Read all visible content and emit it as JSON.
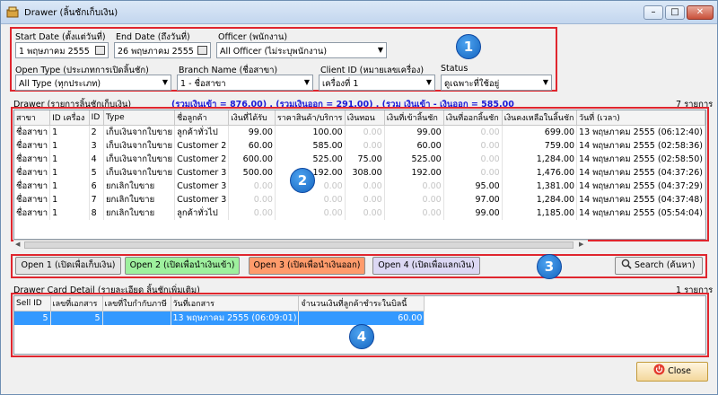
{
  "window": {
    "title": "Drawer (ลิ้นชักเก็บเงิน)",
    "minimize": "–",
    "maximize": "□",
    "close": "✕"
  },
  "filters": {
    "start_date_label": "Start Date (ตั้งแต่วันที่)",
    "start_date_value": "1 พฤษภาคม   2555",
    "end_date_label": "End Date (ถึงวันที่)",
    "end_date_value": "26 พฤษภาคม  2555",
    "officer_label": "Officer (พนักงาน)",
    "officer_value": "All Officer (ไม่ระบุพนักงาน)",
    "open_type_label": "Open Type (ประเภทการเปิดลิ้นชัก)",
    "open_type_value": "All Type (ทุกประเภท)",
    "branch_label": "Branch Name (ชื่อสาขา)",
    "branch_value": "1 - ชื่อสาขา",
    "client_label": "Client ID (หมายเลขเครื่อง)",
    "client_value": "เครื่องที่ 1",
    "status_label": "Status",
    "status_value": "ดูเฉพาะที่ใช้อยู่"
  },
  "drawer": {
    "label": "Drawer (รายการลิ้นชักเก็บเงิน)",
    "summary": "(รวมเงินเข้า = 876.00) , (รวมเงินออก = 291.00) , (รวม เงินเข้า - เงินออก = 585.00",
    "count": "7 รายการ",
    "columns": [
      "สาขา",
      "ID เครื่อง",
      "ID",
      "Type",
      "ชื่อลูกค้า",
      "เงินที่ได้รับ",
      "ราคาสินค้า/บริการ",
      "เงินทอน",
      "เงินที่เข้าลิ้นชัก",
      "เงินที่ออกลิ้นชัก",
      "เงินคงเหลือในลิ้นชัก",
      "วันที่ (เวลา)"
    ],
    "rows": [
      [
        "ชื่อสาขา",
        "1",
        "2",
        "เก็บเงินจากใบขาย",
        "ลูกค้าทั่วไป",
        "99.00",
        "100.00",
        "0.00",
        "99.00",
        "0.00",
        "699.00",
        "13 พฤษภาคม  2555  (06:12:40)"
      ],
      [
        "ชื่อสาขา",
        "1",
        "3",
        "เก็บเงินจากใบขาย",
        "Customer 2",
        "60.00",
        "585.00",
        "0.00",
        "60.00",
        "0.00",
        "759.00",
        "14 พฤษภาคม  2555  (02:58:36)"
      ],
      [
        "ชื่อสาขา",
        "1",
        "4",
        "เก็บเงินจากใบขาย",
        "Customer 2",
        "600.00",
        "525.00",
        "75.00",
        "525.00",
        "0.00",
        "1,284.00",
        "14 พฤษภาคม  2555  (02:58:50)"
      ],
      [
        "ชื่อสาขา",
        "1",
        "5",
        "เก็บเงินจากใบขาย",
        "Customer 3",
        "500.00",
        "192.00",
        "308.00",
        "192.00",
        "0.00",
        "1,476.00",
        "14 พฤษภาคม  2555  (04:37:26)"
      ],
      [
        "ชื่อสาขา",
        "1",
        "6",
        "ยกเลิกใบขาย",
        "Customer 3",
        "0.00",
        "0.00",
        "0.00",
        "0.00",
        "95.00",
        "1,381.00",
        "14 พฤษภาคม  2555  (04:37:29)"
      ],
      [
        "ชื่อสาขา",
        "1",
        "7",
        "ยกเลิกใบขาย",
        "Customer 3",
        "0.00",
        "0.00",
        "0.00",
        "0.00",
        "97.00",
        "1,284.00",
        "14 พฤษภาคม  2555  (04:37:48)"
      ],
      [
        "ชื่อสาขา",
        "1",
        "8",
        "ยกเลิกใบขาย",
        "ลูกค้าทั่วไป",
        "0.00",
        "0.00",
        "0.00",
        "0.00",
        "99.00",
        "1,185.00",
        "14 พฤษภาคม  2555  (05:54:04)"
      ]
    ]
  },
  "actions": {
    "open1": "Open 1 (เปิดเพื่อเก็บเงิน)",
    "open2": "Open 2 (เปิดเพื่อนำเงินเข้า)",
    "open3": "Open 3 (เปิดเพื่อนำเงินออก)",
    "open4": "Open 4 (เปิดเพื่อแลกเงิน)",
    "search": "Search (ค้นหา)"
  },
  "detail": {
    "label": "Drawer Card Detail (รายละเอียด ลิ้นชักเพิ่มเติม)",
    "count": "1 รายการ",
    "columns": [
      "Sell ID",
      "เลขที่เอกสาร",
      "เลขที่ใบกำกับภาษี",
      "วันที่เอกสาร",
      "จำนวนเงินที่ลูกค้าชำระในบิลนี้"
    ],
    "rows": [
      [
        "5",
        "5",
        "",
        "13 พฤษภาคม  2555  (06:09:01)",
        "60.00"
      ]
    ]
  },
  "badges": [
    "1",
    "2",
    "3",
    "4"
  ],
  "close_label": "Close",
  "colors": {
    "open2": "#9ef09e",
    "open3": "#ff9b6b",
    "open4": "#dcd8f4",
    "accent": "#e0262e",
    "summary": "#1a1ad6"
  }
}
